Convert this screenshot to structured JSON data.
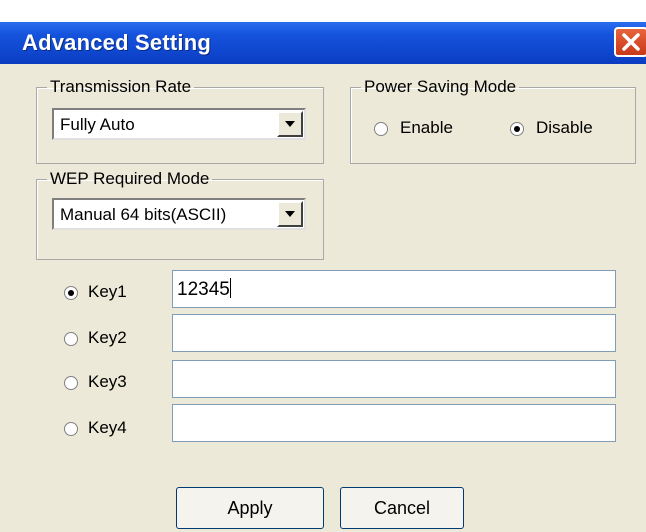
{
  "window": {
    "title": "Advanced Setting"
  },
  "transmission_rate": {
    "legend": "Transmission Rate",
    "selected": "Fully Auto"
  },
  "power_saving": {
    "legend": "Power Saving Mode",
    "options": [
      "Enable",
      "Disable"
    ],
    "selected": "Disable"
  },
  "wep": {
    "legend": "WEP Required Mode",
    "selected": "Manual 64 bits(ASCII)"
  },
  "keys": [
    {
      "label": "Key1",
      "value": "12345",
      "selected": true
    },
    {
      "label": "Key2",
      "value": "",
      "selected": false
    },
    {
      "label": "Key3",
      "value": "",
      "selected": false
    },
    {
      "label": "Key4",
      "value": "",
      "selected": false
    }
  ],
  "buttons": {
    "apply": "Apply",
    "cancel": "Cancel"
  },
  "colors": {
    "titlebar": "#1553dc",
    "dialog_bg": "#ece9d8",
    "close": "#c8391a"
  },
  "icons": {
    "close": "close-icon",
    "dropdown": "chevron-down-icon"
  }
}
